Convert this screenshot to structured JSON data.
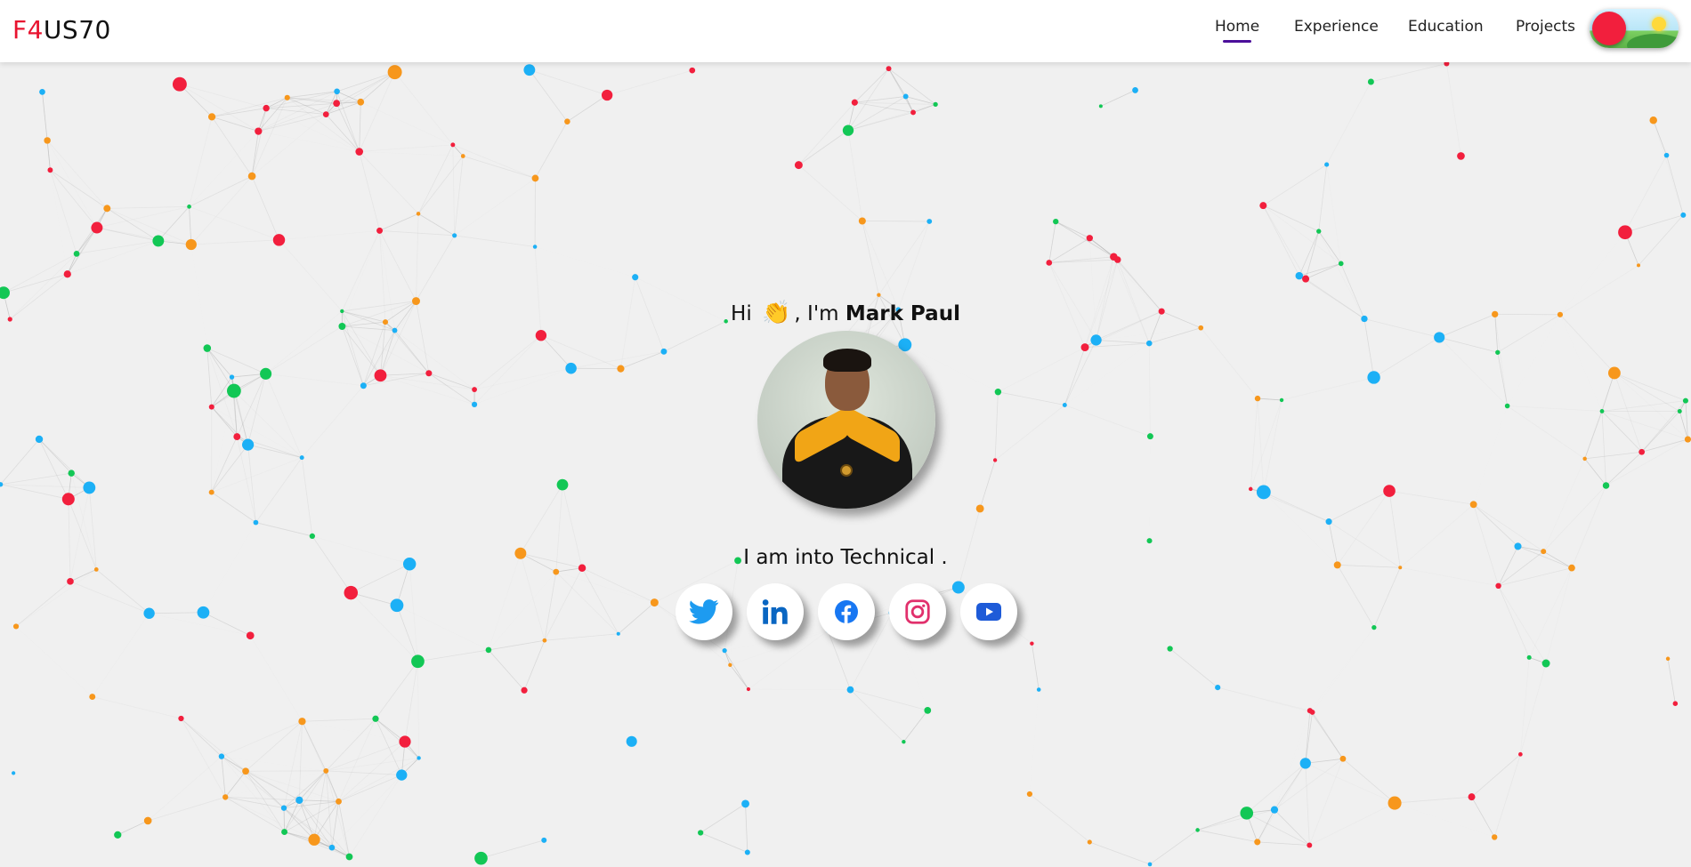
{
  "brand": {
    "prefix": "F4",
    "suffix": "US70",
    "accent_color": "#e8132f"
  },
  "nav": {
    "items": [
      {
        "label": "Home",
        "active": true
      },
      {
        "label": "Experience",
        "active": false
      },
      {
        "label": "Education",
        "active": false
      },
      {
        "label": "Projects",
        "active": false
      }
    ],
    "active_underline_color": "#4b0f9a",
    "theme_toggle": {
      "state": "light",
      "knob_color": "#f21f3d"
    }
  },
  "hero": {
    "greeting_prefix": "Hi",
    "wave_emoji": "👏",
    "greeting_middle": ", I'm",
    "name": "Mark Paul",
    "tagline": "I am into Technical ."
  },
  "socials": [
    {
      "icon": "twitter-icon",
      "color": "#1d9bf0"
    },
    {
      "icon": "linkedin-icon",
      "color": "#0a66c2"
    },
    {
      "icon": "facebook-icon",
      "color": "#1877f2"
    },
    {
      "icon": "instagram-icon",
      "color": "#e1306c"
    },
    {
      "icon": "youtube-icon",
      "color": "#1e5bd8"
    }
  ],
  "background": {
    "node_colors": [
      "#f21f3d",
      "#1cb0f6",
      "#12c755",
      "#f7971c"
    ],
    "line_color": "#9a9a9a"
  }
}
